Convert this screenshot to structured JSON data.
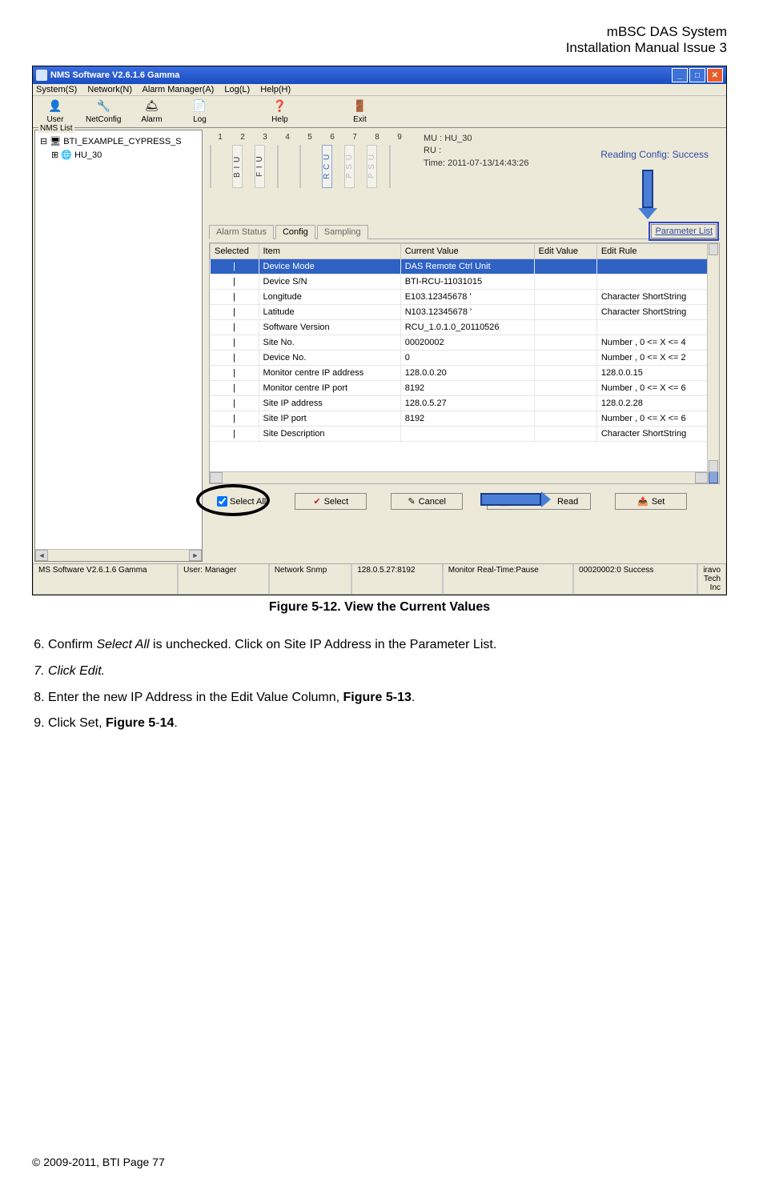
{
  "header": {
    "line1": "mBSC DAS System",
    "line2": "Installation Manual Issue 3"
  },
  "window": {
    "title": "NMS Software V2.6.1.6 Gamma",
    "menus": [
      "System(S)",
      "Network(N)",
      "Alarm Manager(A)",
      "Log(L)",
      "Help(H)"
    ],
    "toolbar": [
      {
        "label": "User",
        "icon": "👤"
      },
      {
        "label": "NetConfig",
        "icon": "🔧"
      },
      {
        "label": "Alarm",
        "icon": "🛎"
      },
      {
        "label": "Log",
        "icon": "📄"
      },
      {
        "label": "Help",
        "icon": "❓"
      },
      {
        "label": "Exit",
        "icon": "🚪"
      }
    ],
    "tree_title": "NMS List",
    "tree": {
      "root": "BTI_EXAMPLE_CYPRESS_S",
      "child": "HU_30"
    },
    "slots": {
      "numbers": [
        "1",
        "2",
        "3",
        "4",
        "5",
        "6",
        "7",
        "8",
        "9"
      ],
      "labels": [
        "",
        "BIU",
        "FIU",
        "",
        "",
        "RCU",
        "PSU",
        "PSU",
        ""
      ],
      "active": [
        false,
        false,
        false,
        false,
        false,
        true,
        false,
        false,
        false
      ],
      "faint": [
        false,
        false,
        false,
        false,
        false,
        false,
        true,
        true,
        false
      ]
    },
    "info": {
      "mu": "MU : HU_30",
      "ru": "RU :",
      "time": "Time: 2011-07-13/14:43:26"
    },
    "reading_status": "Reading Config: Success",
    "tabs": [
      "Alarm Status",
      "Config",
      "Sampling"
    ],
    "active_tab": 1,
    "param_button": "Parameter List",
    "table": {
      "headers": [
        "Selected",
        "Item",
        "Current Value",
        "Edit Value",
        "Edit Rule"
      ],
      "rows": [
        {
          "item": "Device Mode",
          "cv": "DAS Remote Ctrl Unit",
          "ev": "",
          "rule": "",
          "selected": true
        },
        {
          "item": "Device S/N",
          "cv": "BTI-RCU-11031015",
          "ev": "",
          "rule": ""
        },
        {
          "item": "Longitude",
          "cv": "E103.12345678 '",
          "ev": "",
          "rule": "Character ShortString"
        },
        {
          "item": "Latitude",
          "cv": "N103.12345678 '",
          "ev": "",
          "rule": "Character ShortString"
        },
        {
          "item": "Software Version",
          "cv": "RCU_1.0.1.0_20110526",
          "ev": "",
          "rule": ""
        },
        {
          "item": "Site No.",
          "cv": "00020002",
          "ev": "",
          "rule": "Number , 0 <= X <= 4"
        },
        {
          "item": "Device No.",
          "cv": "0",
          "ev": "",
          "rule": "Number , 0 <= X <= 2"
        },
        {
          "item": "Monitor centre IP address",
          "cv": "128.0.0.20",
          "ev": "",
          "rule": "128.0.0.15"
        },
        {
          "item": "Monitor centre IP port",
          "cv": "8192",
          "ev": "",
          "rule": "Number , 0 <= X <= 6"
        },
        {
          "item": "Site IP address",
          "cv": "128.0.5.27",
          "ev": "",
          "rule": "128.0.2.28"
        },
        {
          "item": "Site IP port",
          "cv": "8192",
          "ev": "",
          "rule": "Number , 0 <= X <= 6"
        },
        {
          "item": "Site Description",
          "cv": "",
          "ev": "",
          "rule": "Character ShortString"
        }
      ]
    },
    "buttons": {
      "select_all": "Select All",
      "select": "Select",
      "cancel": "Cancel",
      "read": "Read",
      "set": "Set"
    },
    "statusbar": {
      "app": "MS Software V2.6.1.6 Gamma",
      "user": "User: Manager",
      "snmp": "Network Snmp",
      "addr": "128.0.5.27:8192",
      "monitor": "Monitor Real-Time:Pause",
      "success": "00020002:0 Success",
      "vendor": "iravo Tech Inc"
    }
  },
  "figure_caption": "Figure 5-12. View the Current Values",
  "steps": {
    "s6a": "Confirm ",
    "s6b": "Select All",
    "s6c": " is unchecked. Click on Site IP Address in the Parameter List.",
    "s7a": "Click ",
    "s7b": "Edit.",
    "s8a": "Enter the new IP Address in the Edit Value Column, ",
    "s8b": "Figure 5-13",
    "s8c": ".",
    "s9a": "Click Set, ",
    "s9b": "Figure 5",
    "s9c": "-",
    "s9d": "14",
    "s9e": "."
  },
  "footer": "© 2009‐2011, BTI Page 77"
}
